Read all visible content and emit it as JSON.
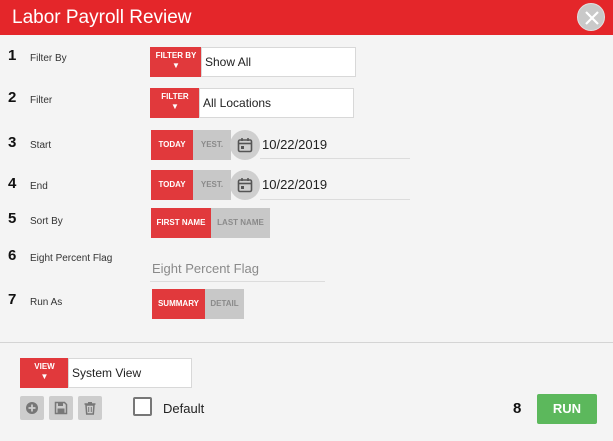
{
  "window": {
    "title": "Labor Payroll Review"
  },
  "rows": [
    {
      "num": "1",
      "label": "Filter By",
      "button": "FILTER BY",
      "value": "Show All"
    },
    {
      "num": "2",
      "label": "Filter",
      "button": "FILTER",
      "value": "All Locations"
    },
    {
      "num": "3",
      "label": "Start",
      "on": "TODAY",
      "off": "YEST.",
      "date": "10/22/2019"
    },
    {
      "num": "4",
      "label": "End",
      "on": "TODAY",
      "off": "YEST.",
      "date": "10/22/2019"
    },
    {
      "num": "5",
      "label": "Sort By",
      "on": "FIRST NAME",
      "off": "LAST NAME"
    },
    {
      "num": "6",
      "label": "Eight Percent Flag",
      "placeholder": "Eight Percent Flag"
    },
    {
      "num": "7",
      "label": "Run As",
      "on": "SUMMARY",
      "off": "DETAIL"
    }
  ],
  "footer": {
    "view_button": "VIEW",
    "view_value": "System View",
    "default_label": "Default",
    "run_num": "8",
    "run_label": "RUN"
  },
  "caret": "▼",
  "colors": {
    "accent": "#e4262a",
    "toggle_on": "#e1393c",
    "toggle_off": "#c8c8c8",
    "run": "#5cb85c"
  },
  "icons": [
    "close-icon",
    "calendar-icon",
    "add-icon",
    "save-icon",
    "trash-icon"
  ]
}
